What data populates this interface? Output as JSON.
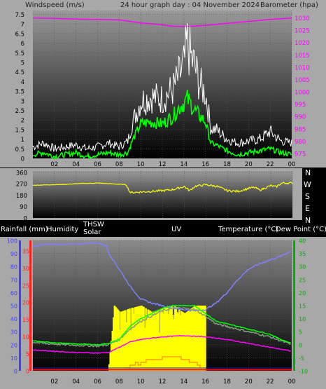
{
  "header": {
    "wind_label": "Windspeed (m/s)",
    "title": "24 hour graph day : 04 November 2024",
    "baro_label": "Barometer (hpa)"
  },
  "colors": {
    "background": "#000000",
    "panel": "#a8a8a8",
    "wind_gust": "#ffffff",
    "wind_avg": "#00ff00",
    "barometer": "#ff00ff",
    "wind_direction": "#ffff00",
    "humidity": "#7f7fff",
    "solar": "#ffff00",
    "uv": "#ff8c00",
    "temperature": "#00ff00",
    "dew_point": "#ff00ff",
    "thsw": "#7fa07f",
    "rainfall": "#ff0000"
  },
  "direction_labels": [
    "N",
    "W",
    "S",
    "E",
    "N"
  ],
  "bottom_labels": {
    "rainfall": "Rainfall (mm)",
    "humidity": "Humidity",
    "thsw": "THSW",
    "solar": "Solar",
    "uv": "UV",
    "temperature": "Temperature (°C)",
    "dew_point": "Dew Point (°C)"
  },
  "chart_data": [
    {
      "type": "line",
      "x_ticks": [
        "02",
        "04",
        "06",
        "08",
        "10",
        "12",
        "14",
        "16",
        "18",
        "20",
        "22",
        "00"
      ],
      "y_left_ticks": [
        "0",
        "0.5",
        "1",
        "1.5",
        "2",
        "2.5",
        "3",
        "3.5",
        "4",
        "4.5",
        "5",
        "5.5",
        "6",
        "6.5",
        "7",
        "7.5"
      ],
      "y_right_ticks": [
        "975",
        "980",
        "985",
        "990",
        "995",
        "1000",
        "1005",
        "1010",
        "1015",
        "1020",
        "1025",
        "1030"
      ],
      "ylim_left": [
        0,
        7.7
      ],
      "ylim_right": [
        973,
        1033
      ],
      "x_range_hours": [
        0,
        24
      ],
      "series": [
        {
          "axis": "left",
          "color": "#ffffff",
          "x": [
            0,
            1,
            2,
            3,
            4,
            5,
            6,
            7,
            8,
            8.8,
            9.2,
            10,
            11,
            12,
            13,
            13.5,
            14,
            14.3,
            14.7,
            15,
            15.5,
            16,
            16.5,
            17,
            18,
            19,
            20,
            21,
            22,
            23,
            24
          ],
          "values": [
            0.6,
            0.8,
            0.5,
            0.6,
            0.7,
            0.5,
            0.6,
            0.8,
            0.6,
            0.9,
            1.8,
            3.0,
            3.2,
            3.1,
            3.6,
            4.2,
            4.8,
            6.0,
            5.2,
            4.8,
            3.8,
            3.4,
            1.6,
            1.5,
            1.0,
            0.8,
            0.9,
            1.0,
            1.4,
            0.9,
            0.8
          ]
        },
        {
          "axis": "left",
          "color": "#00ff00",
          "x": [
            0,
            1,
            2,
            3,
            4,
            5,
            6,
            7,
            8,
            8.8,
            9.2,
            10,
            11,
            12,
            13,
            13.5,
            14,
            14.3,
            14.7,
            15,
            15.5,
            16,
            16.5,
            17,
            18,
            19,
            20,
            21,
            22,
            23,
            24
          ],
          "values": [
            0.2,
            0.3,
            0.1,
            0.2,
            0.3,
            0.1,
            0.2,
            0.3,
            0.2,
            0.3,
            0.9,
            1.8,
            1.9,
            1.8,
            2.2,
            2.6,
            2.9,
            3.1,
            2.8,
            2.5,
            2.2,
            1.9,
            0.8,
            0.7,
            0.4,
            0.2,
            0.3,
            0.4,
            0.5,
            0.3,
            0.2
          ]
        },
        {
          "axis": "right",
          "color": "#ff00ff",
          "x": [
            0,
            2,
            4,
            6,
            8,
            10,
            12,
            13,
            14,
            15,
            16,
            18,
            20,
            22,
            24
          ],
          "values": [
            1030,
            1029.8,
            1029.5,
            1029.4,
            1029.2,
            1028,
            1027.2,
            1026.6,
            1026.5,
            1026.7,
            1027,
            1027.8,
            1028.6,
            1029.4,
            1030
          ]
        }
      ]
    },
    {
      "type": "line",
      "x_ticks": [
        "02",
        "04",
        "06",
        "08",
        "10",
        "12",
        "14",
        "16",
        "18",
        "20",
        "22",
        "00"
      ],
      "y_ticks": [
        "0",
        "90",
        "180",
        "270",
        "360"
      ],
      "ylim": [
        0,
        370
      ],
      "series": [
        {
          "color": "#ffff00",
          "x": [
            0,
            3,
            4.5,
            6,
            7.5,
            8.6,
            9,
            10,
            11,
            12,
            13,
            14,
            14.5,
            15,
            16,
            17,
            18,
            19,
            20,
            20.5,
            21,
            22,
            22.5,
            23,
            24
          ],
          "values": [
            258,
            265,
            272,
            275,
            268,
            263,
            200,
            205,
            210,
            215,
            225,
            248,
            215,
            250,
            262,
            250,
            215,
            210,
            235,
            240,
            220,
            255,
            245,
            275,
            275
          ]
        }
      ]
    },
    {
      "type": "line",
      "x_ticks": [
        "02",
        "04",
        "06",
        "08",
        "10",
        "12",
        "14",
        "16",
        "18",
        "20",
        "22",
        "00"
      ],
      "y_ticks_rain_humidity": [
        "0",
        "10",
        "20",
        "30",
        "40",
        "50",
        "60",
        "70",
        "80",
        "90",
        "100"
      ],
      "y_ticks_red": [
        "0",
        "5",
        "10",
        "15",
        "20",
        "25",
        "30",
        "35"
      ],
      "y_ticks_temperature": [
        "-10",
        "-5",
        "0",
        "5",
        "10",
        "15",
        "20",
        "25",
        "30",
        "35",
        "40"
      ],
      "ylim_humidity": [
        0,
        100
      ],
      "ylim_temperature": [
        -10,
        40
      ],
      "series": [
        {
          "name": "Humidity",
          "color": "#7f7fff",
          "x": [
            0,
            1,
            2,
            3,
            4,
            5,
            6,
            6.8,
            7.2,
            8,
            9,
            10,
            11,
            12,
            13,
            14,
            15,
            16,
            17,
            18,
            19,
            20,
            21,
            22,
            23,
            24
          ],
          "values": [
            95,
            97,
            97,
            97,
            97,
            98,
            98,
            96,
            88,
            78,
            65,
            55,
            52,
            50,
            48,
            47,
            46,
            47,
            52,
            60,
            70,
            78,
            82,
            85,
            88,
            92
          ]
        },
        {
          "name": "Temperature (°C)",
          "color": "#00ff00",
          "x": [
            0,
            1,
            2,
            3,
            4,
            5,
            6,
            7,
            8,
            9,
            10,
            11,
            12,
            13,
            14,
            15,
            16,
            17,
            18,
            19,
            20,
            21,
            22,
            23,
            24
          ],
          "values": [
            1.5,
            1,
            0.8,
            0.5,
            0.3,
            0.2,
            0,
            0.5,
            2,
            7,
            10,
            12,
            14,
            15,
            15,
            15,
            12,
            9,
            8,
            7,
            6,
            5,
            4,
            2,
            0.5
          ]
        },
        {
          "name": "THSW",
          "color": "#7fa07f",
          "x": [
            0,
            1,
            2,
            3,
            4,
            5,
            6,
            7,
            8,
            9,
            10,
            11,
            12,
            13,
            14,
            15,
            16,
            17,
            18,
            19,
            20,
            21,
            22,
            23,
            24
          ],
          "values": [
            1,
            0.5,
            0.3,
            0,
            -0.2,
            -0.3,
            -0.5,
            0,
            2,
            6,
            9,
            11,
            13,
            14,
            14,
            13.5,
            11,
            8,
            7,
            6,
            5,
            4,
            3,
            1.5,
            0
          ]
        },
        {
          "name": "Dew Point (°C)",
          "color": "#ff00ff",
          "x": [
            0,
            2,
            4,
            6,
            7,
            8,
            9,
            10,
            12,
            14,
            16,
            18,
            20,
            22,
            24
          ],
          "values": [
            -2,
            -2.5,
            -3,
            -3.2,
            -3,
            -1,
            1,
            2,
            3,
            3.5,
            3,
            2,
            0.5,
            -1,
            -2.5
          ]
        },
        {
          "name": "Solar",
          "color": "#ffff00",
          "x": [
            7,
            7.5,
            8,
            9,
            10,
            11,
            12,
            13,
            14,
            15,
            15.9,
            16
          ],
          "values": [
            5,
            50,
            45,
            48,
            50,
            45,
            48,
            50,
            44,
            50,
            50,
            0
          ]
        },
        {
          "name": "UV",
          "color": "#ff8c00",
          "x": [
            8.5,
            9,
            10,
            11,
            12,
            13,
            14,
            15,
            15.5
          ],
          "values": [
            1,
            2,
            3,
            4,
            5,
            5,
            4,
            3,
            1
          ]
        },
        {
          "name": "Rainfall (mm)",
          "color": "#ff0000",
          "x": [
            0,
            24
          ],
          "values": [
            0,
            0
          ]
        }
      ]
    }
  ]
}
